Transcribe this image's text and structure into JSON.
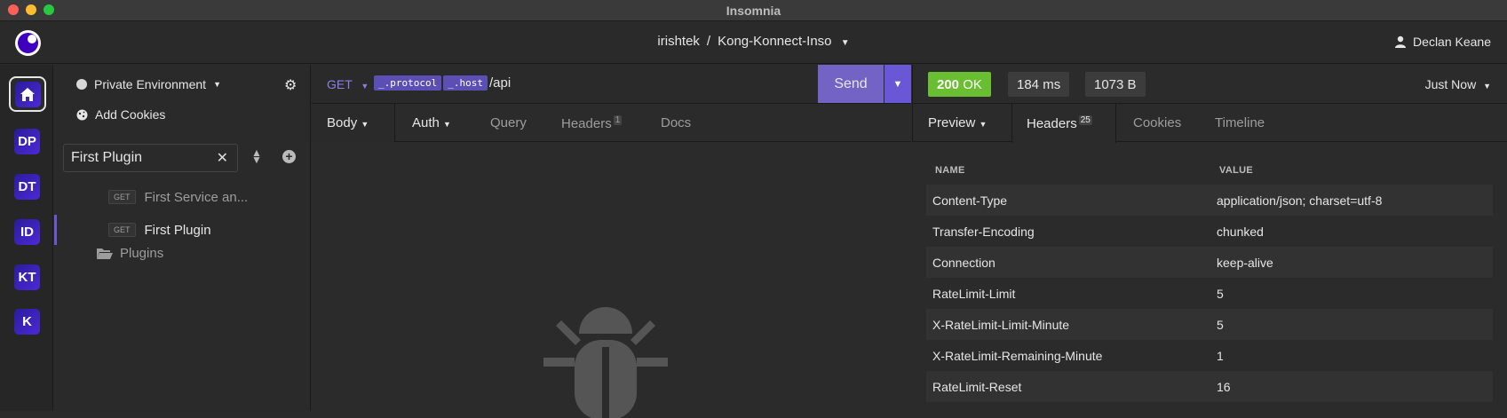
{
  "window": {
    "title": "Insomnia"
  },
  "topbar": {
    "org": "irishtek",
    "separator": "/",
    "project": "Kong-Konnect-Inso",
    "user": "Declan Keane"
  },
  "rail": {
    "workspaces": [
      "DP",
      "DT",
      "ID",
      "KT",
      "K"
    ]
  },
  "sidebar": {
    "environment": "Private Environment",
    "add_cookies": "Add Cookies",
    "filter_value": "First Plugin",
    "requests": [
      {
        "method": "GET",
        "name": "First Service an..."
      },
      {
        "method": "GET",
        "name": "First Plugin"
      }
    ],
    "folder": "Plugins"
  },
  "request": {
    "method": "GET",
    "tags": [
      "_.protocol",
      "_.host"
    ],
    "path": "/api",
    "send_label": "Send",
    "tabs": {
      "body": "Body",
      "auth": "Auth",
      "query": "Query",
      "headers": "Headers",
      "headers_count": "1",
      "docs": "Docs"
    }
  },
  "response": {
    "status": "200 OK",
    "status_code": "200",
    "status_text": "OK",
    "time": "184 ms",
    "size": "1073 B",
    "when": "Just Now",
    "tabs": {
      "preview": "Preview",
      "headers": "Headers",
      "headers_count": "25",
      "cookies": "Cookies",
      "timeline": "Timeline"
    },
    "table": {
      "col_name": "NAME",
      "col_value": "VALUE",
      "rows": [
        {
          "name": "Content-Type",
          "value": "application/json; charset=utf-8"
        },
        {
          "name": "Transfer-Encoding",
          "value": "chunked"
        },
        {
          "name": "Connection",
          "value": "keep-alive"
        },
        {
          "name": "RateLimit-Limit",
          "value": "5"
        },
        {
          "name": "X-RateLimit-Limit-Minute",
          "value": "5"
        },
        {
          "name": "X-RateLimit-Remaining-Minute",
          "value": "1"
        },
        {
          "name": "RateLimit-Reset",
          "value": "16"
        }
      ]
    }
  },
  "colors": {
    "accent": "#6a57d5",
    "ok": "#6abe31",
    "tag": "#5b4fb5"
  }
}
